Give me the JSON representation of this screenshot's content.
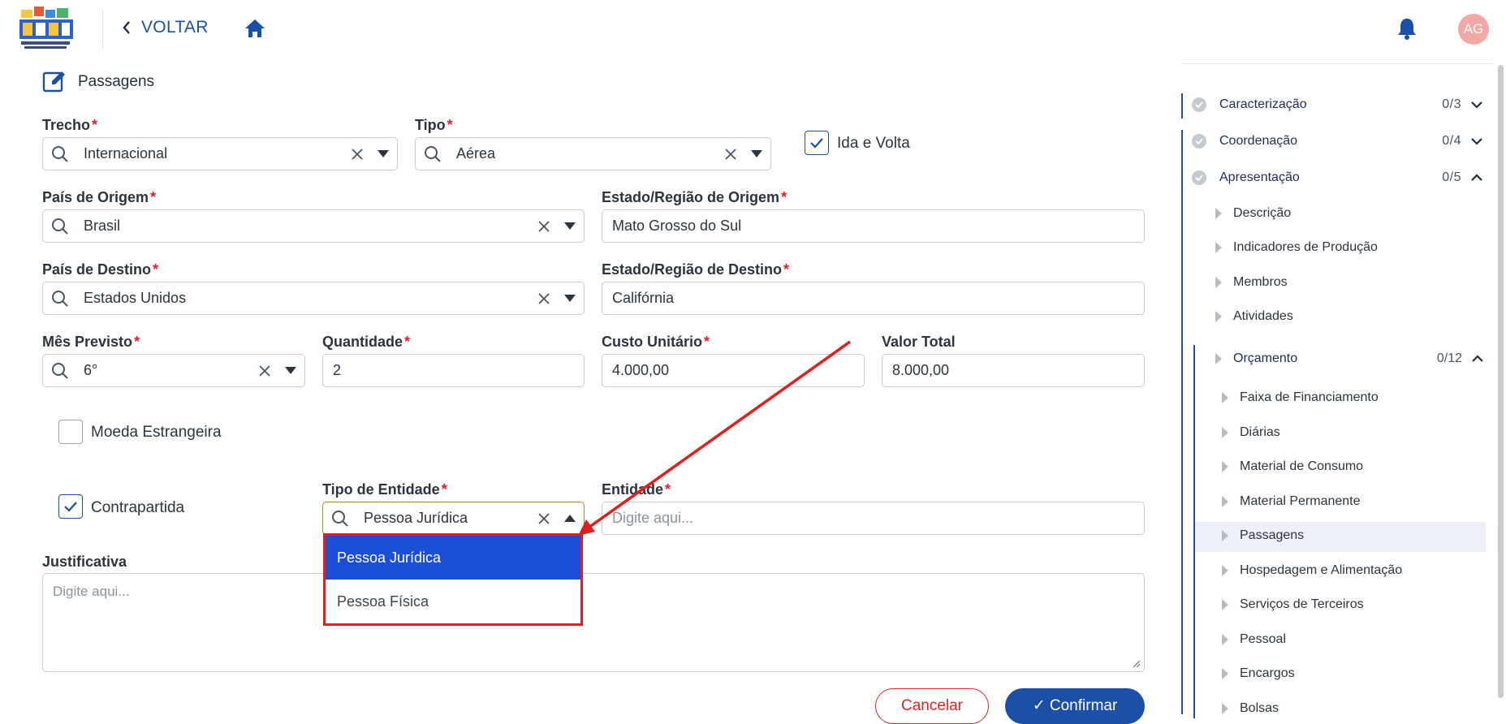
{
  "header": {
    "back_label": "VOLTAR",
    "avatar_initials": "AG"
  },
  "section": {
    "title": "Passagens"
  },
  "form": {
    "trecho": {
      "label": "Trecho",
      "value": "Internacional"
    },
    "tipo": {
      "label": "Tipo",
      "value": "Aérea"
    },
    "ida_volta": {
      "label": "Ida e Volta",
      "checked": true
    },
    "pais_origem": {
      "label": "País de Origem",
      "value": "Brasil"
    },
    "estado_origem": {
      "label": "Estado/Região de Origem",
      "value": "Mato Grosso do Sul"
    },
    "pais_destino": {
      "label": "País de Destino",
      "value": "Estados Unidos"
    },
    "estado_destino": {
      "label": "Estado/Região de Destino",
      "value": "Califórnia"
    },
    "mes_previsto": {
      "label": "Mês Previsto",
      "value": "6°"
    },
    "quantidade": {
      "label": "Quantidade",
      "value": "2"
    },
    "custo_unitario": {
      "label": "Custo Unitário",
      "value": "4.000,00"
    },
    "valor_total": {
      "label": "Valor Total",
      "value": "8.000,00"
    },
    "moeda_estrangeira": {
      "label": "Moeda Estrangeira",
      "checked": false
    },
    "contrapartida": {
      "label": "Contrapartida",
      "checked": true
    },
    "tipo_entidade": {
      "label": "Tipo de Entidade",
      "value": "Pessoa Jurídica",
      "options": [
        "Pessoa Jurídica",
        "Pessoa Física"
      ]
    },
    "entidade": {
      "label": "Entidade",
      "placeholder": "Digite aqui..."
    },
    "justificativa": {
      "label": "Justificativa",
      "placeholder": "Digite aqui..."
    },
    "required_mark": "*",
    "cancel_label": "Cancelar",
    "confirm_label": "✓ Confirmar"
  },
  "sidebar": {
    "top_items": [
      {
        "label": "Caracterização",
        "count": "0/3"
      },
      {
        "label": "Coordenação",
        "count": "0/4"
      },
      {
        "label": "Apresentação",
        "count": "0/5"
      }
    ],
    "apresentacao_items": [
      "Descrição",
      "Indicadores de Produção",
      "Membros",
      "Atividades"
    ],
    "orcamento": {
      "label": "Orçamento",
      "count": "0/12"
    },
    "orcamento_items": [
      "Faixa de Financiamento",
      "Diárias",
      "Material de Consumo",
      "Material Permanente",
      "Passagens",
      "Hospedagem e Alimentação",
      "Serviços de Terceiros",
      "Pessoal",
      "Encargos",
      "Bolsas"
    ]
  },
  "colors": {
    "brand": "#1c4fa8",
    "required": "#e11d2e",
    "selected_option": "#1c4fd8",
    "annotation": "#e11d1d"
  }
}
